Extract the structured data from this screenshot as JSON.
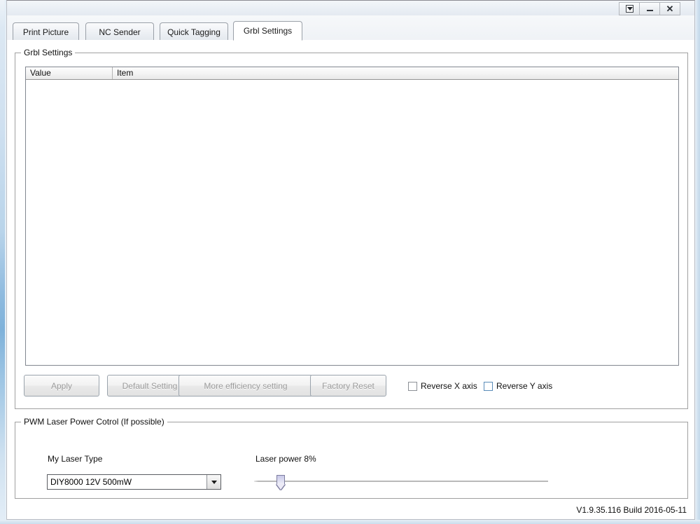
{
  "window": {
    "title": "",
    "controls": [
      {
        "name": "restore-down-button",
        "icon": "restore-down-icon",
        "label": ""
      },
      {
        "name": "minimize-button",
        "icon": "minimize-icon",
        "label": ""
      },
      {
        "name": "close-button",
        "icon": "close-icon",
        "label": "✕"
      }
    ]
  },
  "tabs": [
    {
      "label": "Print Picture",
      "active": false
    },
    {
      "label": "NC Sender",
      "active": false
    },
    {
      "label": "Quick Tagging",
      "active": false
    },
    {
      "label": "Grbl Settings",
      "active": true
    }
  ],
  "grbl_group": {
    "legend": "Grbl Settings",
    "table": {
      "columns": [
        "Value",
        "Item"
      ],
      "rows": []
    },
    "buttons": [
      {
        "label": "Apply",
        "enabled": false
      },
      {
        "label": "Default Setting",
        "enabled": false
      },
      {
        "label": "More efficiency setting",
        "enabled": false
      },
      {
        "label": "Factory Reset",
        "enabled": false
      }
    ],
    "checkboxes": [
      {
        "label": "Reverse X axis",
        "checked": false
      },
      {
        "label": "Reverse Y axis",
        "checked": false
      }
    ]
  },
  "pwm_group": {
    "legend": "PWM Laser Power Cotrol (If possible)",
    "laser_type_label": "My Laser Type",
    "laser_type_value": "DIY8000 12V 500mW",
    "laser_power_label": "Laser power 8%",
    "laser_power_percent": 8
  },
  "footer": {
    "version": "V1.9.35.116 Build 2016-05-11"
  },
  "colors": {
    "accent_blue": "#7fb2da",
    "disabled_text": "#9b9b9b",
    "border": "#a0a0a0"
  }
}
